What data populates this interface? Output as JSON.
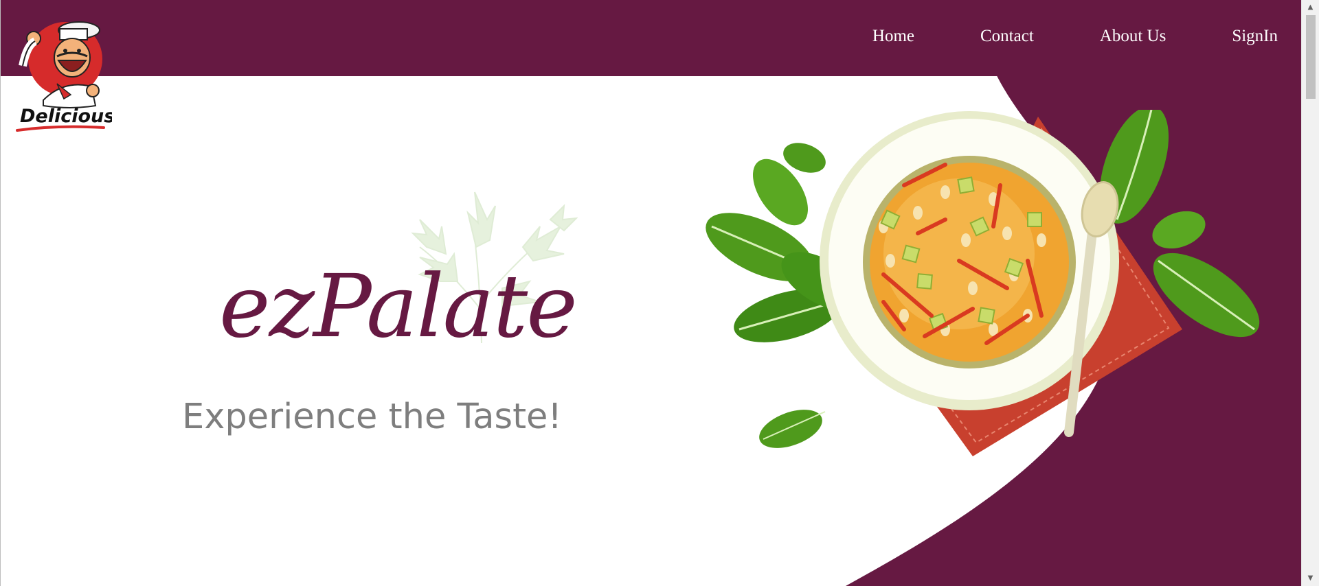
{
  "nav": {
    "items": [
      {
        "label": "Home"
      },
      {
        "label": "Contact"
      },
      {
        "label": "About Us"
      },
      {
        "label": "SignIn"
      }
    ]
  },
  "logo": {
    "text": "Delicious!",
    "icon": "chef-mascot-icon"
  },
  "hero": {
    "title": "ezPalate",
    "tagline": "Experience the Taste!",
    "image": "soup-bowl-illustration",
    "decoration": "parsley-sprig"
  },
  "colors": {
    "brand": "#661942",
    "white": "#ffffff",
    "tagline": "#7e7e7e",
    "soup": "#f0a430",
    "napkin": "#c8402e",
    "leaf": "#4f9a1c"
  },
  "scrollbar": {
    "up_glyph": "▲",
    "down_glyph": "▼"
  }
}
